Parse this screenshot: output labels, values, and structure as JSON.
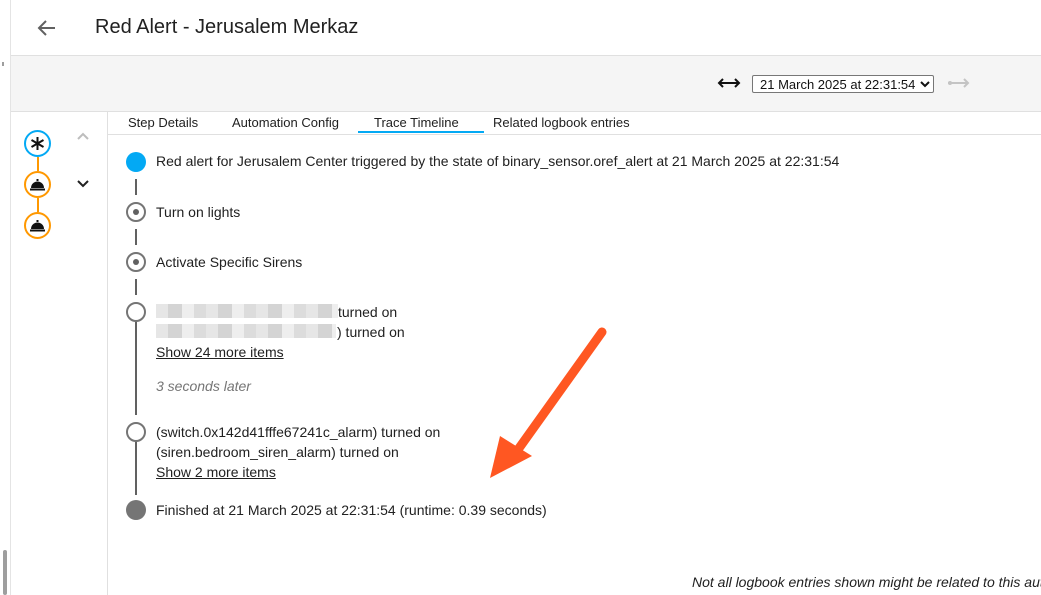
{
  "header": {
    "back_icon": "arrow-left-icon",
    "title": "Red Alert - Jerusalem Merkaz"
  },
  "toolbar": {
    "fit_icon": "arrow-left-right-icon",
    "run_selected": "21 March 2025 at 22:31:54",
    "run_options": [
      "21 March 2025 at 22:31:54"
    ],
    "next_icon": "arrow-right-disabled-icon"
  },
  "graph": {
    "trigger_icon": "asterisk-icon",
    "action_icon": "service-bell-icon",
    "collapse_icon": "chevron-up-icon",
    "expand_icon": "chevron-down-icon"
  },
  "tabs": [
    {
      "label": "Step Details",
      "active": false
    },
    {
      "label": "Automation Config",
      "active": false
    },
    {
      "label": "Trace Timeline",
      "active": true
    },
    {
      "label": "Related logbook entries",
      "active": false
    }
  ],
  "timeline": {
    "trigger": "Red alert for Jerusalem Center triggered by the state of binary_sensor.oref_alert at 21 March 2025 at 22:31:54",
    "step1": "Turn on lights",
    "step2": "Activate Specific Sirens",
    "logbook1": {
      "line1_suffix": "turned on",
      "line2_suffix": ") turned on",
      "more": "Show 24 more items"
    },
    "gap": "3 seconds later",
    "logbook2": {
      "line1": "(switch.0x142d41fffe67241c_alarm) turned on",
      "line2": "(siren.bedroom_siren_alarm) turned on",
      "more": "Show 2 more items"
    },
    "finished": "Finished at 21 March 2025 at 22:31:54 (runtime: 0.39 seconds)"
  },
  "footer_note": "Not all logbook entries shown might be related to this automation.",
  "colors": {
    "accent": "#03a9f4",
    "action_node": "#ff9800",
    "annotation_arrow": "#ff5722"
  }
}
